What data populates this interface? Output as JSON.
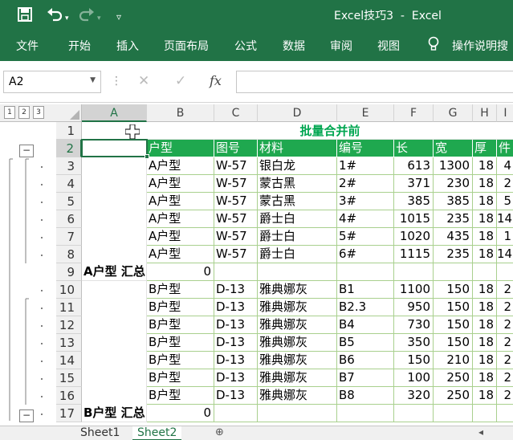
{
  "app": {
    "title": "Excel技巧3  -  Excel",
    "brand_color": "#217346",
    "header_fill": "#1fa84f",
    "title_color": "#00a651"
  },
  "quick_access": {
    "save_icon": "save-icon",
    "undo_icon": "undo-icon",
    "redo_icon": "redo-icon",
    "customize_icon": "customize-icon"
  },
  "ribbon": {
    "tabs": [
      "文件",
      "开始",
      "插入",
      "页面布局",
      "公式",
      "数据",
      "审阅",
      "视图"
    ],
    "tell_me": "操作说明搜"
  },
  "formula_bar": {
    "name_box": "A2",
    "fx": "fx",
    "formula": ""
  },
  "outline_levels": [
    "1",
    "2",
    "3"
  ],
  "columns": [
    "A",
    "B",
    "C",
    "D",
    "E",
    "F",
    "G",
    "H",
    "I"
  ],
  "rows": [
    "1",
    "2",
    "3",
    "4",
    "5",
    "6",
    "7",
    "8",
    "9",
    "10",
    "11",
    "12",
    "13",
    "14",
    "15",
    "16",
    "17"
  ],
  "sheet": {
    "title": "批量合并前",
    "header": [
      "户型",
      "图号",
      "材料",
      "编号",
      "长",
      "宽",
      "厚",
      "件"
    ],
    "data": [
      [
        "A户型",
        "W-57",
        "银白龙",
        "1#",
        "613",
        "1300",
        "18",
        "4"
      ],
      [
        "A户型",
        "W-57",
        "蒙古黑",
        "2#",
        "371",
        "230",
        "18",
        "2"
      ],
      [
        "A户型",
        "W-57",
        "蒙古黑",
        "3#",
        "385",
        "385",
        "18",
        "5"
      ],
      [
        "A户型",
        "W-57",
        "爵士白",
        "4#",
        "1015",
        "235",
        "18",
        "14"
      ],
      [
        "A户型",
        "W-57",
        "爵士白",
        "5#",
        "1020",
        "435",
        "18",
        "1"
      ],
      [
        "A户型",
        "W-57",
        "爵士白",
        "6#",
        "1115",
        "235",
        "18",
        "14"
      ],
      [
        "B户型",
        "D-13",
        "雅典娜灰",
        "B1",
        "1100",
        "150",
        "18",
        "2"
      ],
      [
        "B户型",
        "D-13",
        "雅典娜灰",
        "B2.3",
        "950",
        "150",
        "18",
        "2"
      ],
      [
        "B户型",
        "D-13",
        "雅典娜灰",
        "B4",
        "730",
        "150",
        "18",
        "2"
      ],
      [
        "B户型",
        "D-13",
        "雅典娜灰",
        "B5",
        "350",
        "150",
        "18",
        "2"
      ],
      [
        "B户型",
        "D-13",
        "雅典娜灰",
        "B6",
        "150",
        "210",
        "18",
        "2"
      ],
      [
        "B户型",
        "D-13",
        "雅典娜灰",
        "B7",
        "100",
        "250",
        "18",
        "2"
      ],
      [
        "B户型",
        "D-13",
        "雅典娜灰",
        "B8",
        "320",
        "250",
        "18",
        "2"
      ]
    ],
    "subtotal_a": {
      "label": "A户型 汇总",
      "value": "0"
    },
    "subtotal_b": {
      "label": "B户型 汇总",
      "value": "0"
    }
  },
  "outline_icons": {
    "collapse": "−"
  },
  "sheets": [
    "Sheet1",
    "Sheet2"
  ],
  "active_sheet": "Sheet2",
  "add_sheet_icon": "plus-icon"
}
